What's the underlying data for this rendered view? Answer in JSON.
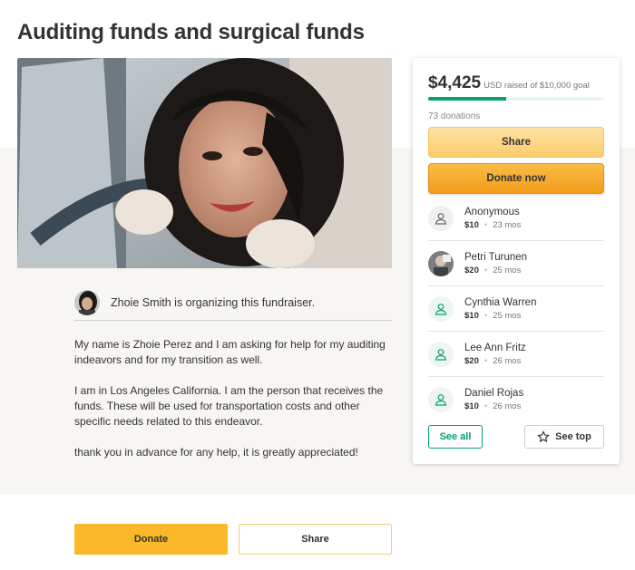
{
  "page": {
    "title": "Auditing funds and surgical funds"
  },
  "organizer": {
    "text": "Zhoie Smith is organizing this fundraiser."
  },
  "story": {
    "paragraphs": [
      "My name is Zhoie Perez and I am asking for help for my auditing indeavors and for my transition as well.",
      "I am in Los Angeles California. I am the person that receives the funds. These will be used for transportation costs and other specific needs related to this endeavor.",
      "thank you in advance for any help, it is greatly appreciated!"
    ]
  },
  "card": {
    "amount": "$4,425",
    "goal_text": "USD raised of $10,000 goal",
    "progress_fraction": 0.4425,
    "donations_count": "73 donations",
    "share_label": "Share",
    "donate_label": "Donate now",
    "see_all_label": "See all",
    "see_top_label": "See top",
    "donors": [
      {
        "name": "Anonymous",
        "amount": "$10",
        "time": "23 mos",
        "avatar": "user-icon"
      },
      {
        "name": "Petri Turunen",
        "amount": "$20",
        "time": "25 mos",
        "avatar": "photo"
      },
      {
        "name": "Cynthia Warren",
        "amount": "$10",
        "time": "25 mos",
        "avatar": "user-icon"
      },
      {
        "name": "Lee Ann Fritz",
        "amount": "$20",
        "time": "26 mos",
        "avatar": "user-icon"
      },
      {
        "name": "Daniel Rojas",
        "amount": "$10",
        "time": "26 mos",
        "avatar": "user-icon"
      }
    ]
  },
  "bottom": {
    "donate_label": "Donate",
    "share_label": "Share"
  },
  "colors": {
    "accent_green": "#05a074",
    "donate_orange": "#f39c1c",
    "share_yellow": "#fbcc6d"
  }
}
